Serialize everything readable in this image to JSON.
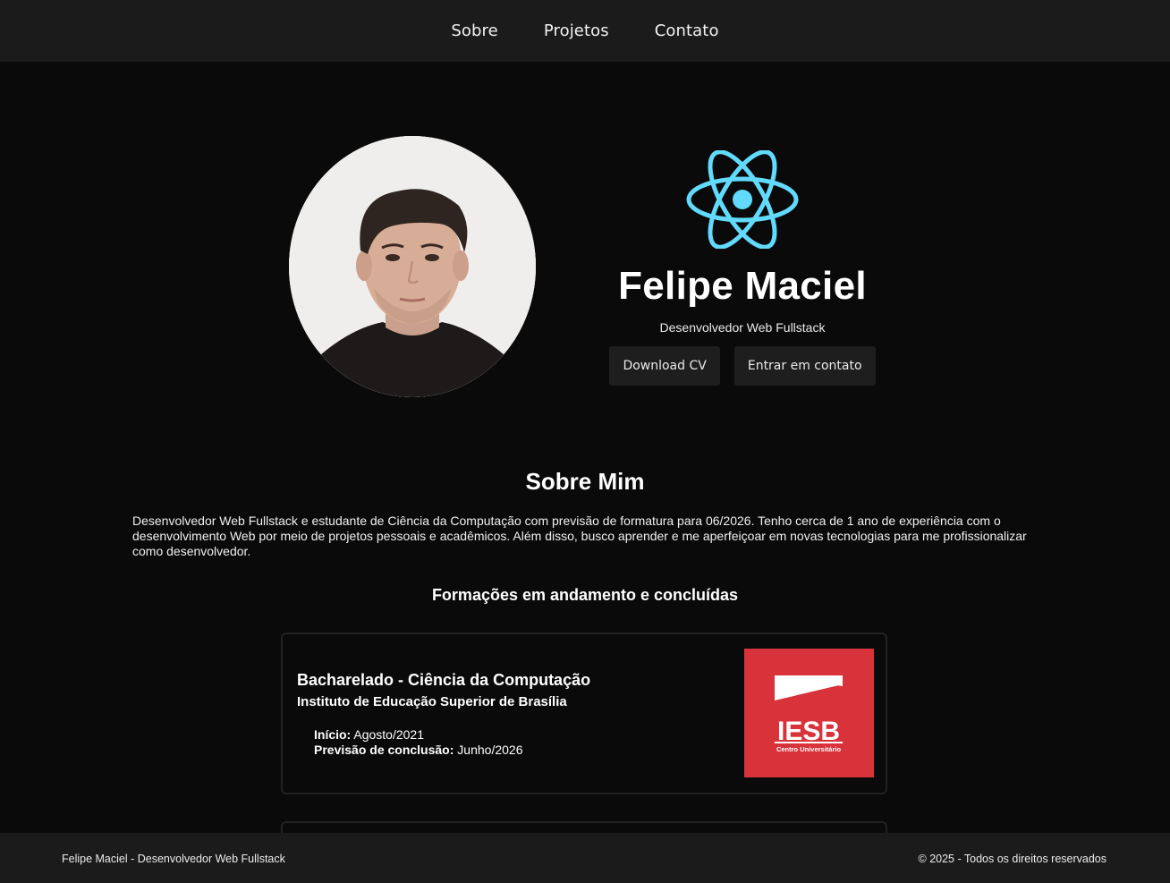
{
  "nav": {
    "items": [
      "Sobre",
      "Projetos",
      "Contato"
    ]
  },
  "hero": {
    "name": "Felipe Maciel",
    "subtitle": "Desenvolvedor Web Fullstack",
    "download_cv_label": "Download CV",
    "contact_label": "Entrar em contato",
    "logo_icon": "react-icon",
    "logo_color": "#61dafb"
  },
  "about": {
    "title": "Sobre Mim",
    "text": "Desenvolvedor Web Fullstack e estudante de Ciência da Computação com previsão de formatura para 06/2026. Tenho cerca de 1 ano de experiência com o desenvolvimento Web por meio de projetos pessoais e acadêmicos. Além disso, busco aprender e me aperfeiçoar em novas tecnologias para me profissionalizar como desenvolvedor."
  },
  "education": {
    "title": "Formações em andamento e concluídas",
    "items": [
      {
        "course": "Bacharelado - Ciência da Computação",
        "institution": "Instituto de Educação Superior de Brasília",
        "start_label": "Início:",
        "start_value": "Agosto/2021",
        "end_label": "Previsão de conclusão:",
        "end_value": "Junho/2026",
        "logo_text": "IESB",
        "logo_subtext": "Centro Universitário",
        "logo_color": "#d8323b"
      }
    ]
  },
  "footer": {
    "left": "Felipe Maciel - Desenvolvedor Web Fullstack",
    "right": "© 2025 - Todos os direitos reservados"
  }
}
